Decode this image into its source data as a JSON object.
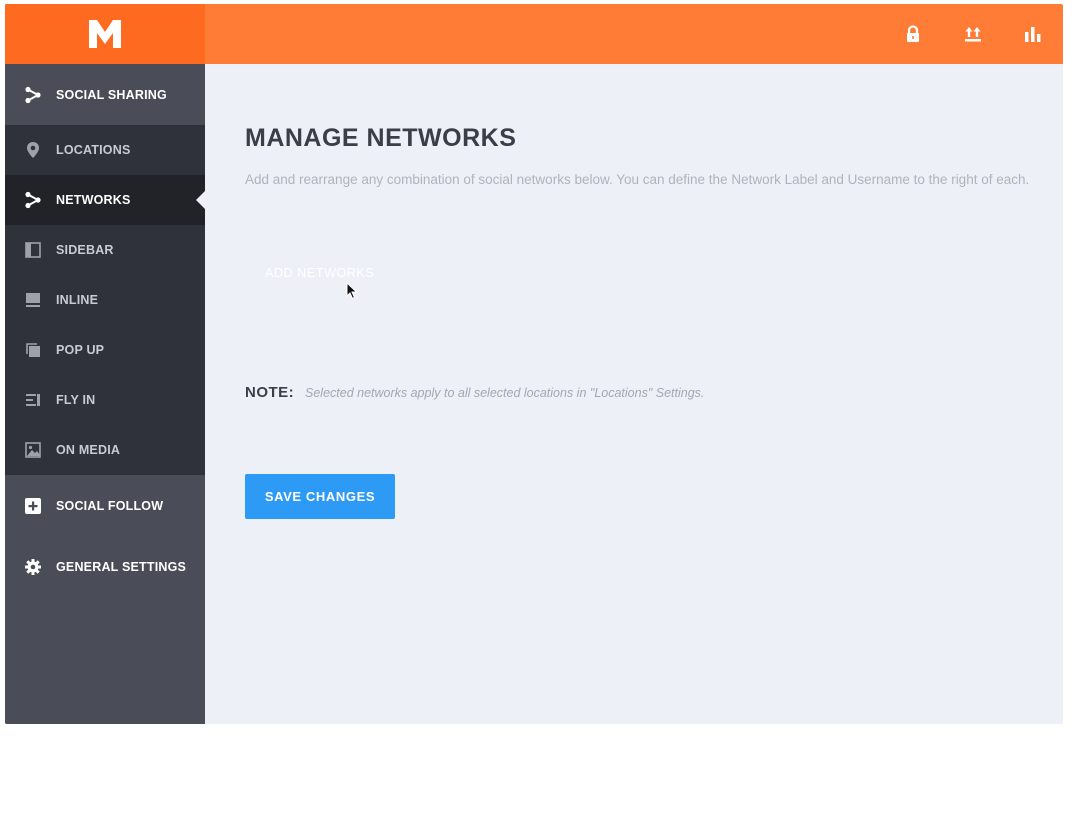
{
  "brand": {
    "logo_icon": "m-logo-icon",
    "color_primary": "#ff6a21",
    "color_topbar": "#ff7c37"
  },
  "topbar": {
    "icons": [
      "lock-icon",
      "upload-icon",
      "bar-chart-icon"
    ]
  },
  "sidebar": {
    "items": [
      {
        "label": "SOCIAL SHARING",
        "icon": "share-icon",
        "type": "section"
      },
      {
        "label": "LOCATIONS",
        "icon": "location-pin-icon",
        "type": "sub"
      },
      {
        "label": "NETWORKS",
        "icon": "share-icon",
        "type": "sub",
        "active": true
      },
      {
        "label": "SIDEBAR",
        "icon": "sidebar-layout-icon",
        "type": "sub"
      },
      {
        "label": "INLINE",
        "icon": "inline-layout-icon",
        "type": "sub"
      },
      {
        "label": "POP UP",
        "icon": "popup-icon",
        "type": "sub"
      },
      {
        "label": "FLY IN",
        "icon": "fly-in-icon",
        "type": "sub"
      },
      {
        "label": "ON MEDIA",
        "icon": "image-icon",
        "type": "sub"
      },
      {
        "label": "SOCIAL FOLLOW",
        "icon": "plus-square-icon",
        "type": "section"
      },
      {
        "label": "GENERAL SETTINGS",
        "icon": "gear-icon",
        "type": "section"
      }
    ]
  },
  "main": {
    "title": "MANAGE NETWORKS",
    "description": "Add and rearrange any combination of social networks below. You can define the Network Label and Username to the right of each.",
    "add_networks_label": "ADD NETWORKS",
    "note_label": "NOTE:",
    "note_text": "Selected networks apply to all selected locations in \"Locations\" Settings.",
    "save_label": "SAVE CHANGES",
    "accent_color": "#2d9bf5"
  }
}
